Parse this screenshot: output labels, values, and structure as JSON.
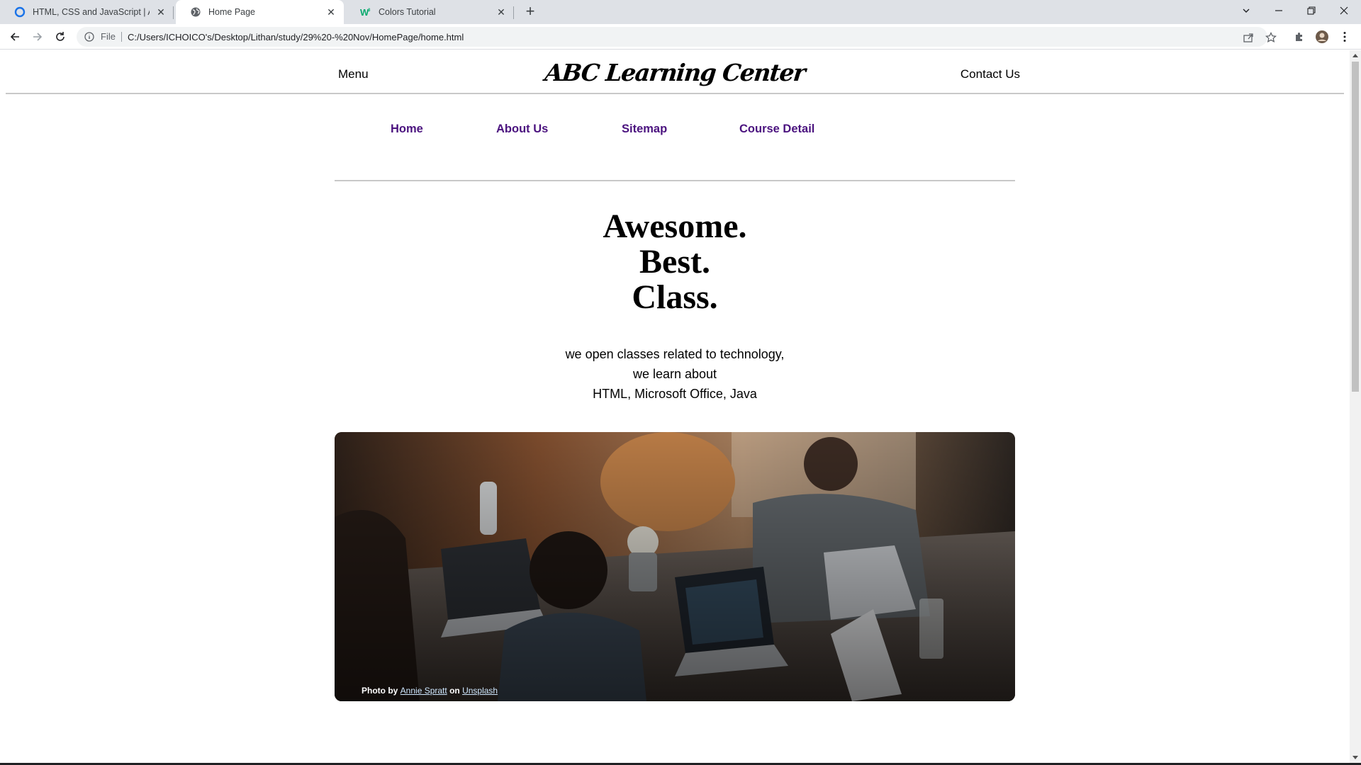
{
  "browser": {
    "tabs": [
      {
        "title": "HTML, CSS and JavaScript | Assig",
        "favicon": "ring-icon",
        "active": false
      },
      {
        "title": "Home Page",
        "favicon": "globe-icon",
        "active": true
      },
      {
        "title": "Colors Tutorial",
        "favicon": "w3-icon",
        "active": false
      }
    ],
    "address": {
      "scheme_label": "File",
      "url": "C:/Users/ICHOICO's/Desktop/Lithan/study/29%20-%20Nov/HomePage/home.html"
    }
  },
  "header": {
    "menu_label": "Menu",
    "brand": "ABC Learning Center",
    "contact_label": "Contact Us"
  },
  "nav": {
    "items": [
      "Home",
      "About Us",
      "Sitemap",
      "Course Detail"
    ],
    "link_color": "#4b137f"
  },
  "hero": {
    "lines": [
      "Awesome.",
      "Best.",
      "Class."
    ],
    "subtitle_lines": [
      "we open classes related to technology,",
      "we learn about",
      "HTML, Microsoft Office, Java"
    ]
  },
  "photo": {
    "credit_prefix": "Photo by",
    "author": "Annie Spratt",
    "credit_mid": "on",
    "source": "Unsplash"
  }
}
